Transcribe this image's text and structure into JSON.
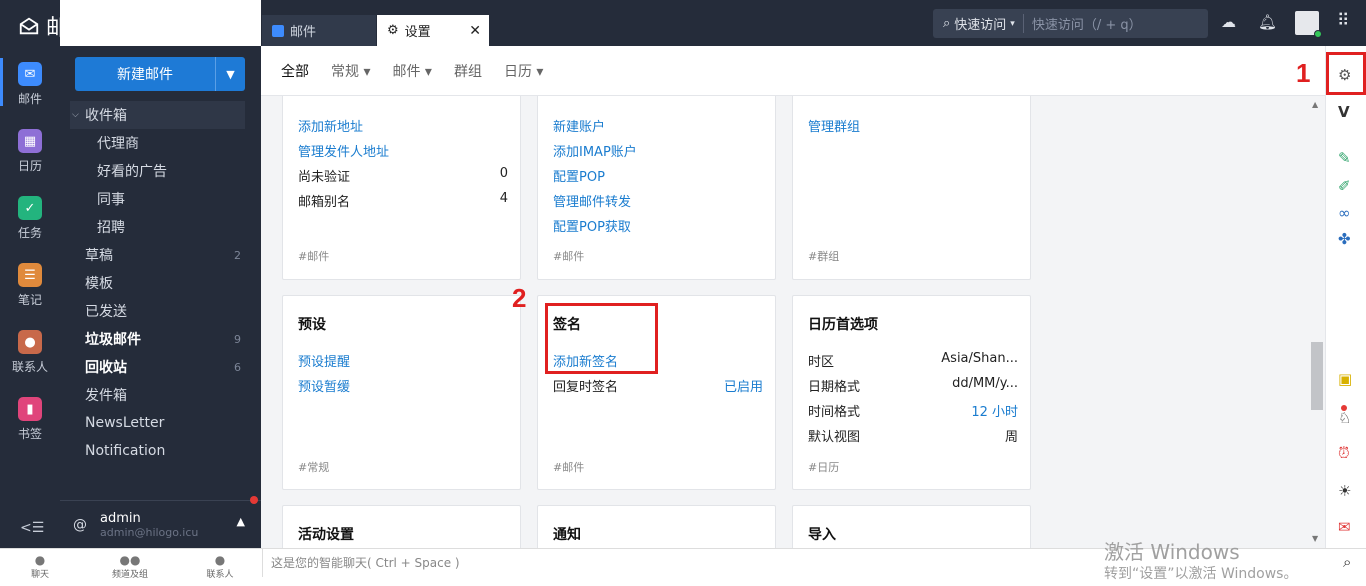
{
  "app": {
    "title": "邮件"
  },
  "rail": [
    {
      "label": "邮件",
      "icon": "mail-icon",
      "color": "#3d8bfd"
    },
    {
      "label": "日历",
      "icon": "calendar-icon",
      "color": "#8e6fd6"
    },
    {
      "label": "任务",
      "icon": "check-icon",
      "color": "#23b47e"
    },
    {
      "label": "笔记",
      "icon": "note-icon",
      "color": "#e08a3c"
    },
    {
      "label": "联系人",
      "icon": "contact-icon",
      "color": "#c8694a"
    },
    {
      "label": "书签",
      "icon": "bookmark-icon",
      "color": "#e0457b"
    }
  ],
  "new_mail": {
    "label": "新建邮件"
  },
  "folders": [
    {
      "name": "收件箱",
      "count": ""
    },
    {
      "name": "代理商",
      "count": ""
    },
    {
      "name": "好看的广告",
      "count": ""
    },
    {
      "name": "同事",
      "count": ""
    },
    {
      "name": "招聘",
      "count": ""
    },
    {
      "name": "草稿",
      "count": "2"
    },
    {
      "name": "模板",
      "count": ""
    },
    {
      "name": "已发送",
      "count": ""
    },
    {
      "name": "垃圾邮件",
      "count": "9"
    },
    {
      "name": "回收站",
      "count": "6"
    },
    {
      "name": "发件箱",
      "count": ""
    },
    {
      "name": "NewsLetter",
      "count": ""
    },
    {
      "name": "Notification",
      "count": ""
    }
  ],
  "user": {
    "at": "@",
    "name": "admin",
    "email": "admin@hilogo.icu"
  },
  "tabs": {
    "mail": "邮件",
    "settings": "设置"
  },
  "quick": {
    "label": "快速访问",
    "placeholder": "快速访问（/ + q）"
  },
  "subnav": [
    "全部",
    "常规",
    "邮件",
    "群组",
    "日历"
  ],
  "cards": {
    "c1": {
      "links": [
        "添加新地址",
        "管理发件人地址"
      ],
      "rows": [
        [
          "尚未验证",
          "0"
        ],
        [
          "邮箱别名",
          "4"
        ]
      ],
      "tag": "#邮件"
    },
    "c2": {
      "links": [
        "新建账户",
        "添加IMAP账户",
        "配置POP",
        "管理邮件转发",
        "配置POP获取"
      ],
      "tag": "#邮件"
    },
    "c3": {
      "links": [
        "管理群组"
      ],
      "tag": "#群组"
    },
    "preset": {
      "title": "预设",
      "links": [
        "预设提醒",
        "预设暂缓"
      ],
      "tag": "#常规"
    },
    "signature": {
      "title": "签名",
      "link": "添加新签名",
      "row_label": "回复时签名",
      "row_value": "已启用",
      "tag": "#邮件"
    },
    "calendar": {
      "title": "日历首选项",
      "rows": [
        [
          "时区",
          "Asia/Shan..."
        ],
        [
          "日期格式",
          "dd/MM/y..."
        ],
        [
          "时间格式",
          "12 小时"
        ],
        [
          "默认视图",
          "周"
        ]
      ],
      "tag": "#日历"
    },
    "activity": {
      "title": "活动设置"
    },
    "notify": {
      "title": "通知"
    },
    "import": {
      "title": "导入"
    }
  },
  "bottom": {
    "items": [
      "聊天",
      "频道及组",
      "联系人"
    ],
    "chat_placeholder": "这是您的智能聊天( Ctrl + Space )"
  },
  "watermark": {
    "line1": "激活 Windows",
    "line2": "转到“设置”以激活 Windows。"
  },
  "annotations": {
    "one": "1",
    "two": "2"
  }
}
